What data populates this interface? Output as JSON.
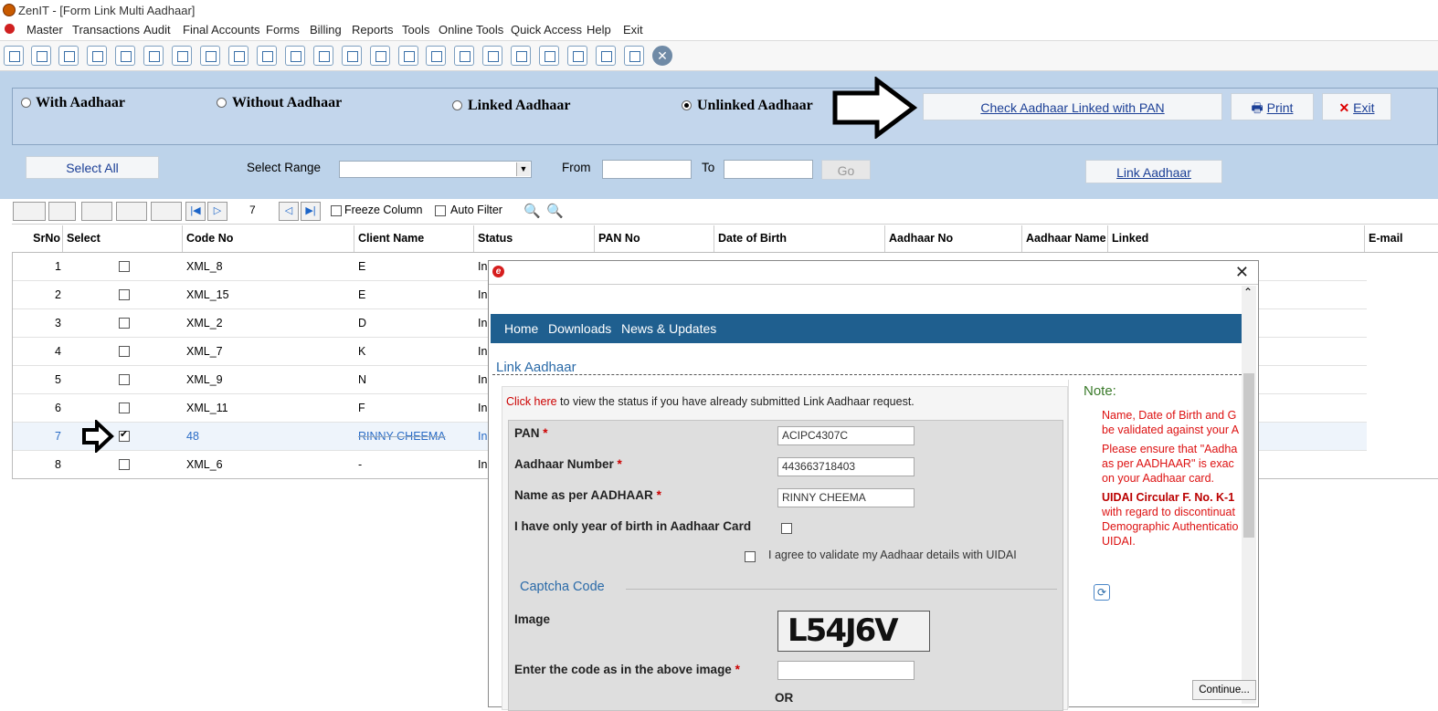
{
  "window": {
    "title": "ZenIT - [Form Link Multi Aadhaar]"
  },
  "menu": [
    "Master",
    "Transactions",
    "Audit",
    "Final Accounts",
    "Forms",
    "Billing",
    "Reports",
    "Tools",
    "Online Tools",
    "Quick Access",
    "Help",
    "Exit"
  ],
  "toolbar": {
    "icons": [
      "rupee-icon",
      "home-icon",
      "building-icon",
      "chart-icon",
      "gift-icon",
      "users-icon",
      "pin-icon",
      "filter-icon",
      "tax-icon",
      "audio-icon",
      "calculator-icon",
      "pie-icon",
      "pay-icon",
      "book-icon",
      "info-icon",
      "report-icon",
      "user-doc-icon",
      "calendar-icon",
      "folder-add-icon",
      "bs-icon",
      "3cd-icon",
      "doc-icon",
      "fac-icon",
      "close-icon"
    ]
  },
  "radios": {
    "with_aadhaar": "With Aadhaar",
    "without_aadhaar": "Without Aadhaar",
    "linked_aadhaar": "Linked Aadhaar",
    "unlinked_aadhaar": "Unlinked Aadhaar"
  },
  "buttons": {
    "check_pan": "Check Aadhaar Linked with PAN",
    "print": "Print",
    "exit": "Exit",
    "select_all": "Select All",
    "go": "Go",
    "link_aadhaar": "Link Aadhaar"
  },
  "range": {
    "label": "Select Range",
    "from": "From",
    "to": "To"
  },
  "gridtools": {
    "page": "7",
    "freeze": "Freeze Column",
    "autofilter": "Auto Filter"
  },
  "columns": [
    "SrNo",
    "Select",
    "Code No",
    "Client Name",
    "Status",
    "PAN No",
    "Date of Birth",
    "Aadhaar No",
    "Aadhaar Name",
    "Linked",
    "E-mail"
  ],
  "rows": [
    {
      "sr": "1",
      "code": "XML_8",
      "client": "E",
      "status": "In",
      "checked": false
    },
    {
      "sr": "2",
      "code": "XML_15",
      "client": "E",
      "status": "In",
      "checked": false
    },
    {
      "sr": "3",
      "code": "XML_2",
      "client": "D",
      "status": "In",
      "checked": false
    },
    {
      "sr": "4",
      "code": "XML_7",
      "client": "K",
      "status": "In",
      "checked": false
    },
    {
      "sr": "5",
      "code": "XML_9",
      "client": "N",
      "status": "In",
      "checked": false
    },
    {
      "sr": "6",
      "code": "XML_11",
      "client": "F",
      "status": "In",
      "checked": false
    },
    {
      "sr": "7",
      "code": "48",
      "client": "RINNY CHEEMA",
      "status": "In",
      "checked": true
    },
    {
      "sr": "8",
      "code": "XML_6",
      "client": "-",
      "status": "In",
      "checked": false
    }
  ],
  "dialog": {
    "nav": [
      "Home",
      "Downloads",
      "News & Updates"
    ],
    "heading": "Link Aadhaar",
    "click_here": "Click here",
    "status_text": " to view the status if you have already submitted Link Aadhaar request.",
    "pan_label": "PAN",
    "pan_value": "ACIPC4307C",
    "aadhaar_label": "Aadhaar Number",
    "aadhaar_value": "443663718403",
    "name_label": "Name as per AADHAAR",
    "name_value": "RINNY CHEEMA",
    "yob_label": "I have only year of birth in Aadhaar Card",
    "agree_label": "I agree to validate my Aadhaar details with UIDAI",
    "captcha_section": "Captcha Code",
    "image_label": "Image",
    "captcha_text": "L54J6V",
    "code_label": "Enter the code as in the above image",
    "or_text": "OR",
    "note_title": "Note:",
    "note1": "Name, Date of Birth and G",
    "note1b": "be validated against your A",
    "note2": "Please ensure that \"Aadha",
    "note2b": "as per AADHAAR\" is exac",
    "note2c": "on your Aadhaar card.",
    "note3": "UIDAI Circular F. No. K-1",
    "note3b": "with regard to discontinuat",
    "note3c": "Demographic Authenticatio",
    "note3d": "UIDAI.",
    "continue": "Continue..."
  }
}
